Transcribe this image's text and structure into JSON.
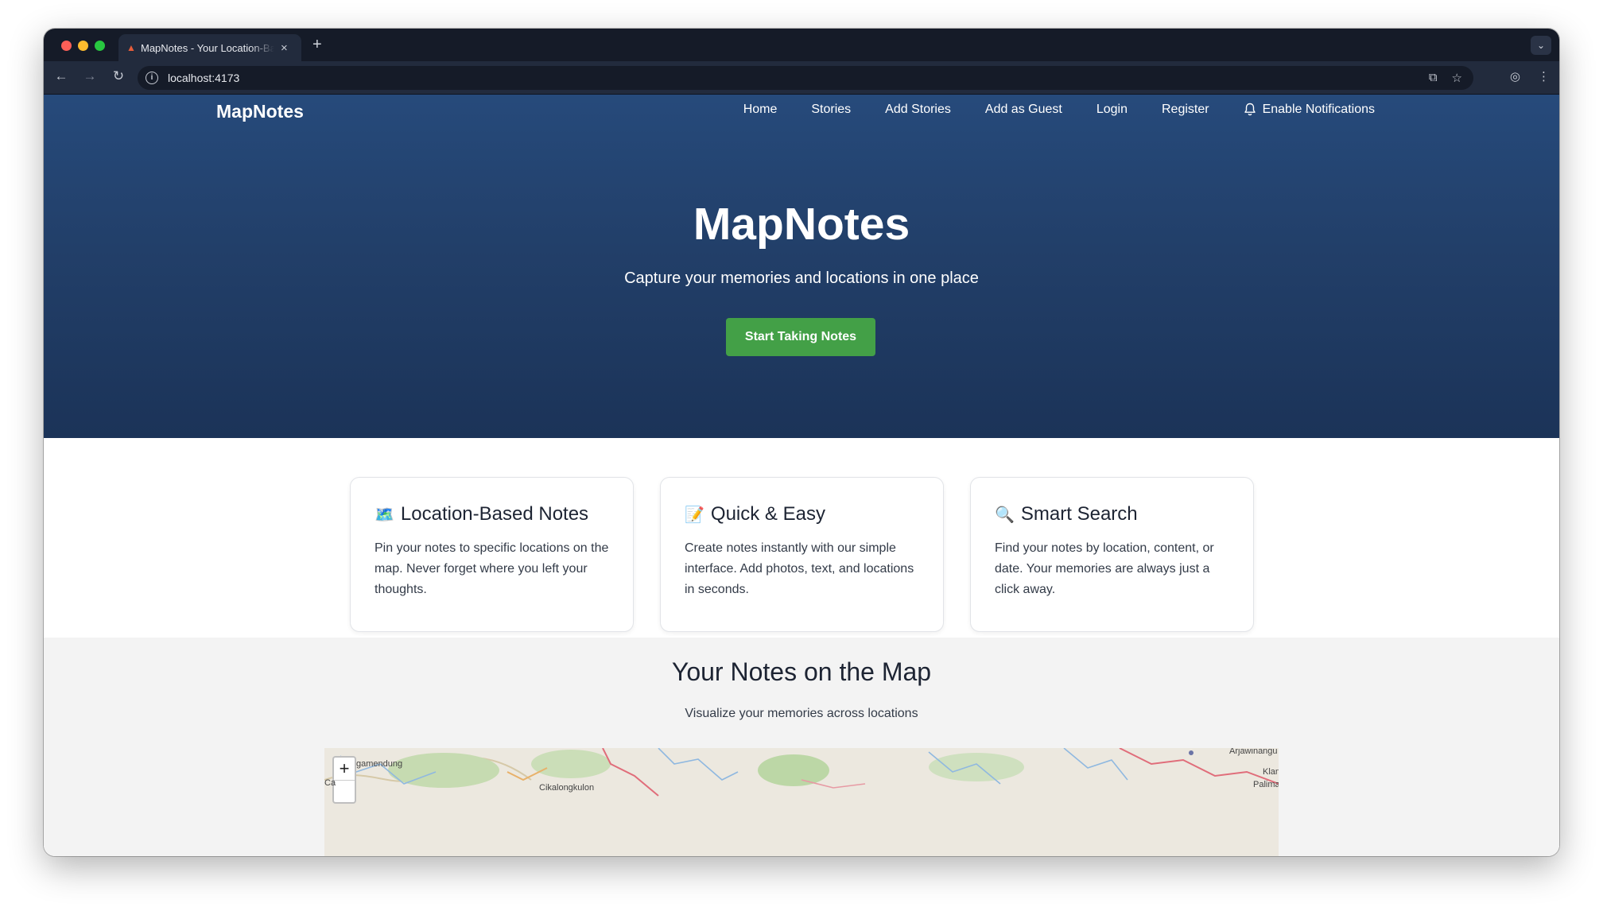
{
  "browser": {
    "tab_title": "MapNotes - Your Location-Based Notes",
    "url": "localhost:4173"
  },
  "nav": {
    "brand": "MapNotes",
    "items": [
      "Home",
      "Stories",
      "Add Stories",
      "Add as Guest",
      "Login",
      "Register"
    ],
    "notifications_label": "Enable Notifications"
  },
  "hero": {
    "title": "MapNotes",
    "subtitle": "Capture your memories and locations in one place",
    "cta_label": "Start Taking Notes",
    "cta_color": "#43a047"
  },
  "features": [
    {
      "icon": "🗺️",
      "title": "Location-Based Notes",
      "text": "Pin your notes to specific locations on the map. Never forget where you left your thoughts."
    },
    {
      "icon": "📝",
      "title": "Quick & Easy",
      "text": "Create notes instantly with our simple interface. Add photos, text, and locations in seconds."
    },
    {
      "icon": "🔍",
      "title": "Smart Search",
      "text": "Find your notes by location, content, or date. Your memories are always just a click away."
    }
  ],
  "map_section": {
    "title": "Your Notes on the Map",
    "subtitle": "Visualize your memories across locations",
    "zoom_in": "+",
    "labels": [
      "gamendung",
      "Cikalongkulon",
      "Arjawinangu",
      "Klan",
      "Palima",
      "Ca"
    ]
  }
}
